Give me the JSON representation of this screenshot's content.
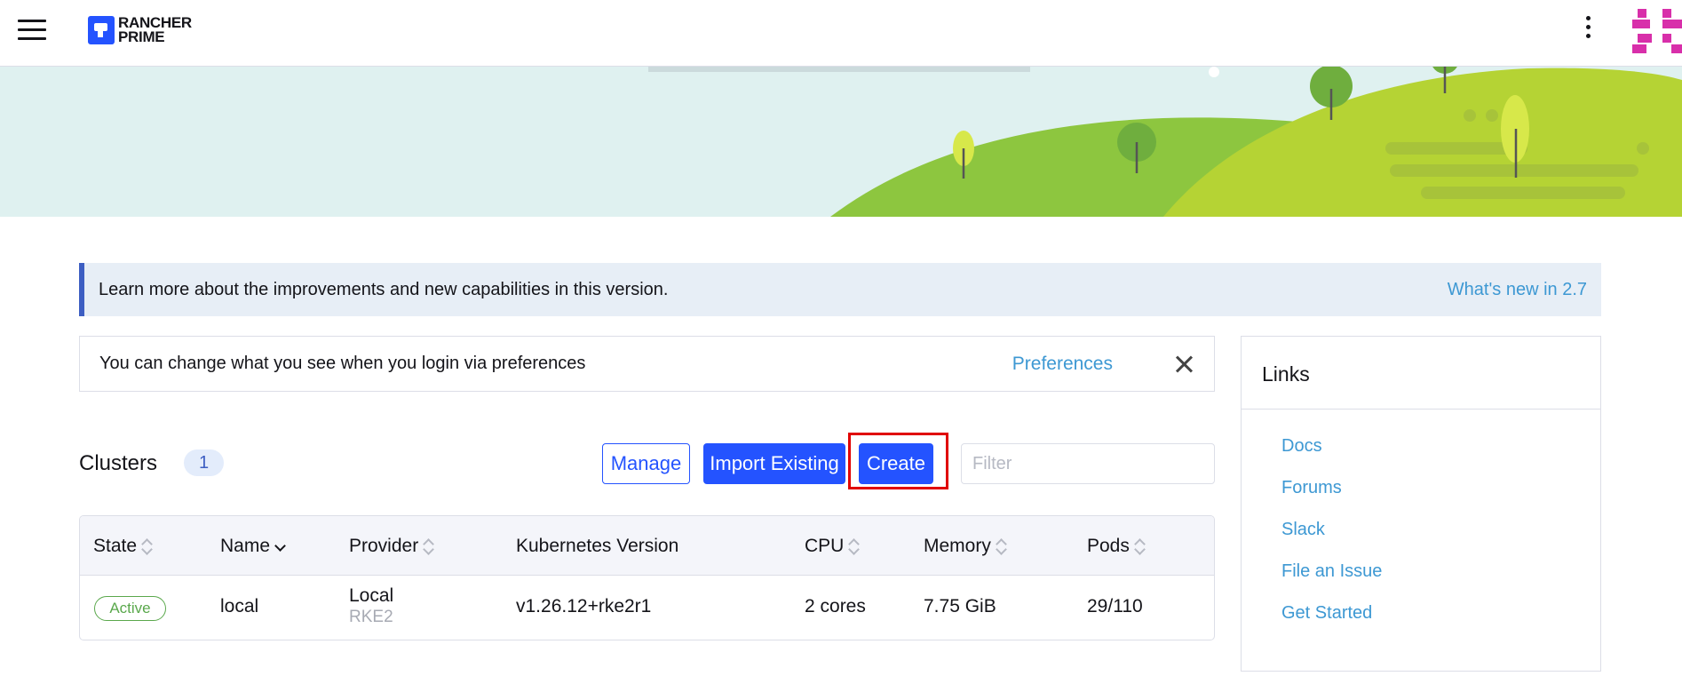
{
  "header": {
    "logo_line1": "RANCHER",
    "logo_line2": "PRIME",
    "menu_icon": "hamburger-icon",
    "more_icon": "vertical-dots-icon",
    "avatar_color": "#d82faa"
  },
  "banner": {
    "sky_color": "#dff1f0",
    "hill_colors": [
      "#8dc63f",
      "#b5d334"
    ]
  },
  "notice": {
    "text": "Learn more about the improvements and new capabilities in this version.",
    "link": "What's new in 2.7"
  },
  "preferences": {
    "text": "You can change what you see when you login via preferences",
    "link": "Preferences",
    "close_icon": "close-icon"
  },
  "clusters": {
    "title": "Clusters",
    "count": "1",
    "buttons": {
      "manage": "Manage",
      "import": "Import Existing",
      "create": "Create"
    },
    "filter_placeholder": "Filter",
    "columns": [
      "State",
      "Name",
      "Provider",
      "Kubernetes Version",
      "CPU",
      "Memory",
      "Pods"
    ],
    "rows": [
      {
        "state": "Active",
        "name": "local",
        "provider": "Local",
        "provider_sub": "RKE2",
        "version": "v1.26.12+rke2r1",
        "cpu": "2 cores",
        "memory": "7.75 GiB",
        "pods": "29/110"
      }
    ]
  },
  "links": {
    "title": "Links",
    "items": [
      "Docs",
      "Forums",
      "Slack",
      "File an Issue",
      "Get Started"
    ]
  },
  "colors": {
    "primary": "#2453ff",
    "link": "#3d98d3",
    "active": "#5aa84c",
    "highlight": "#e00000"
  }
}
